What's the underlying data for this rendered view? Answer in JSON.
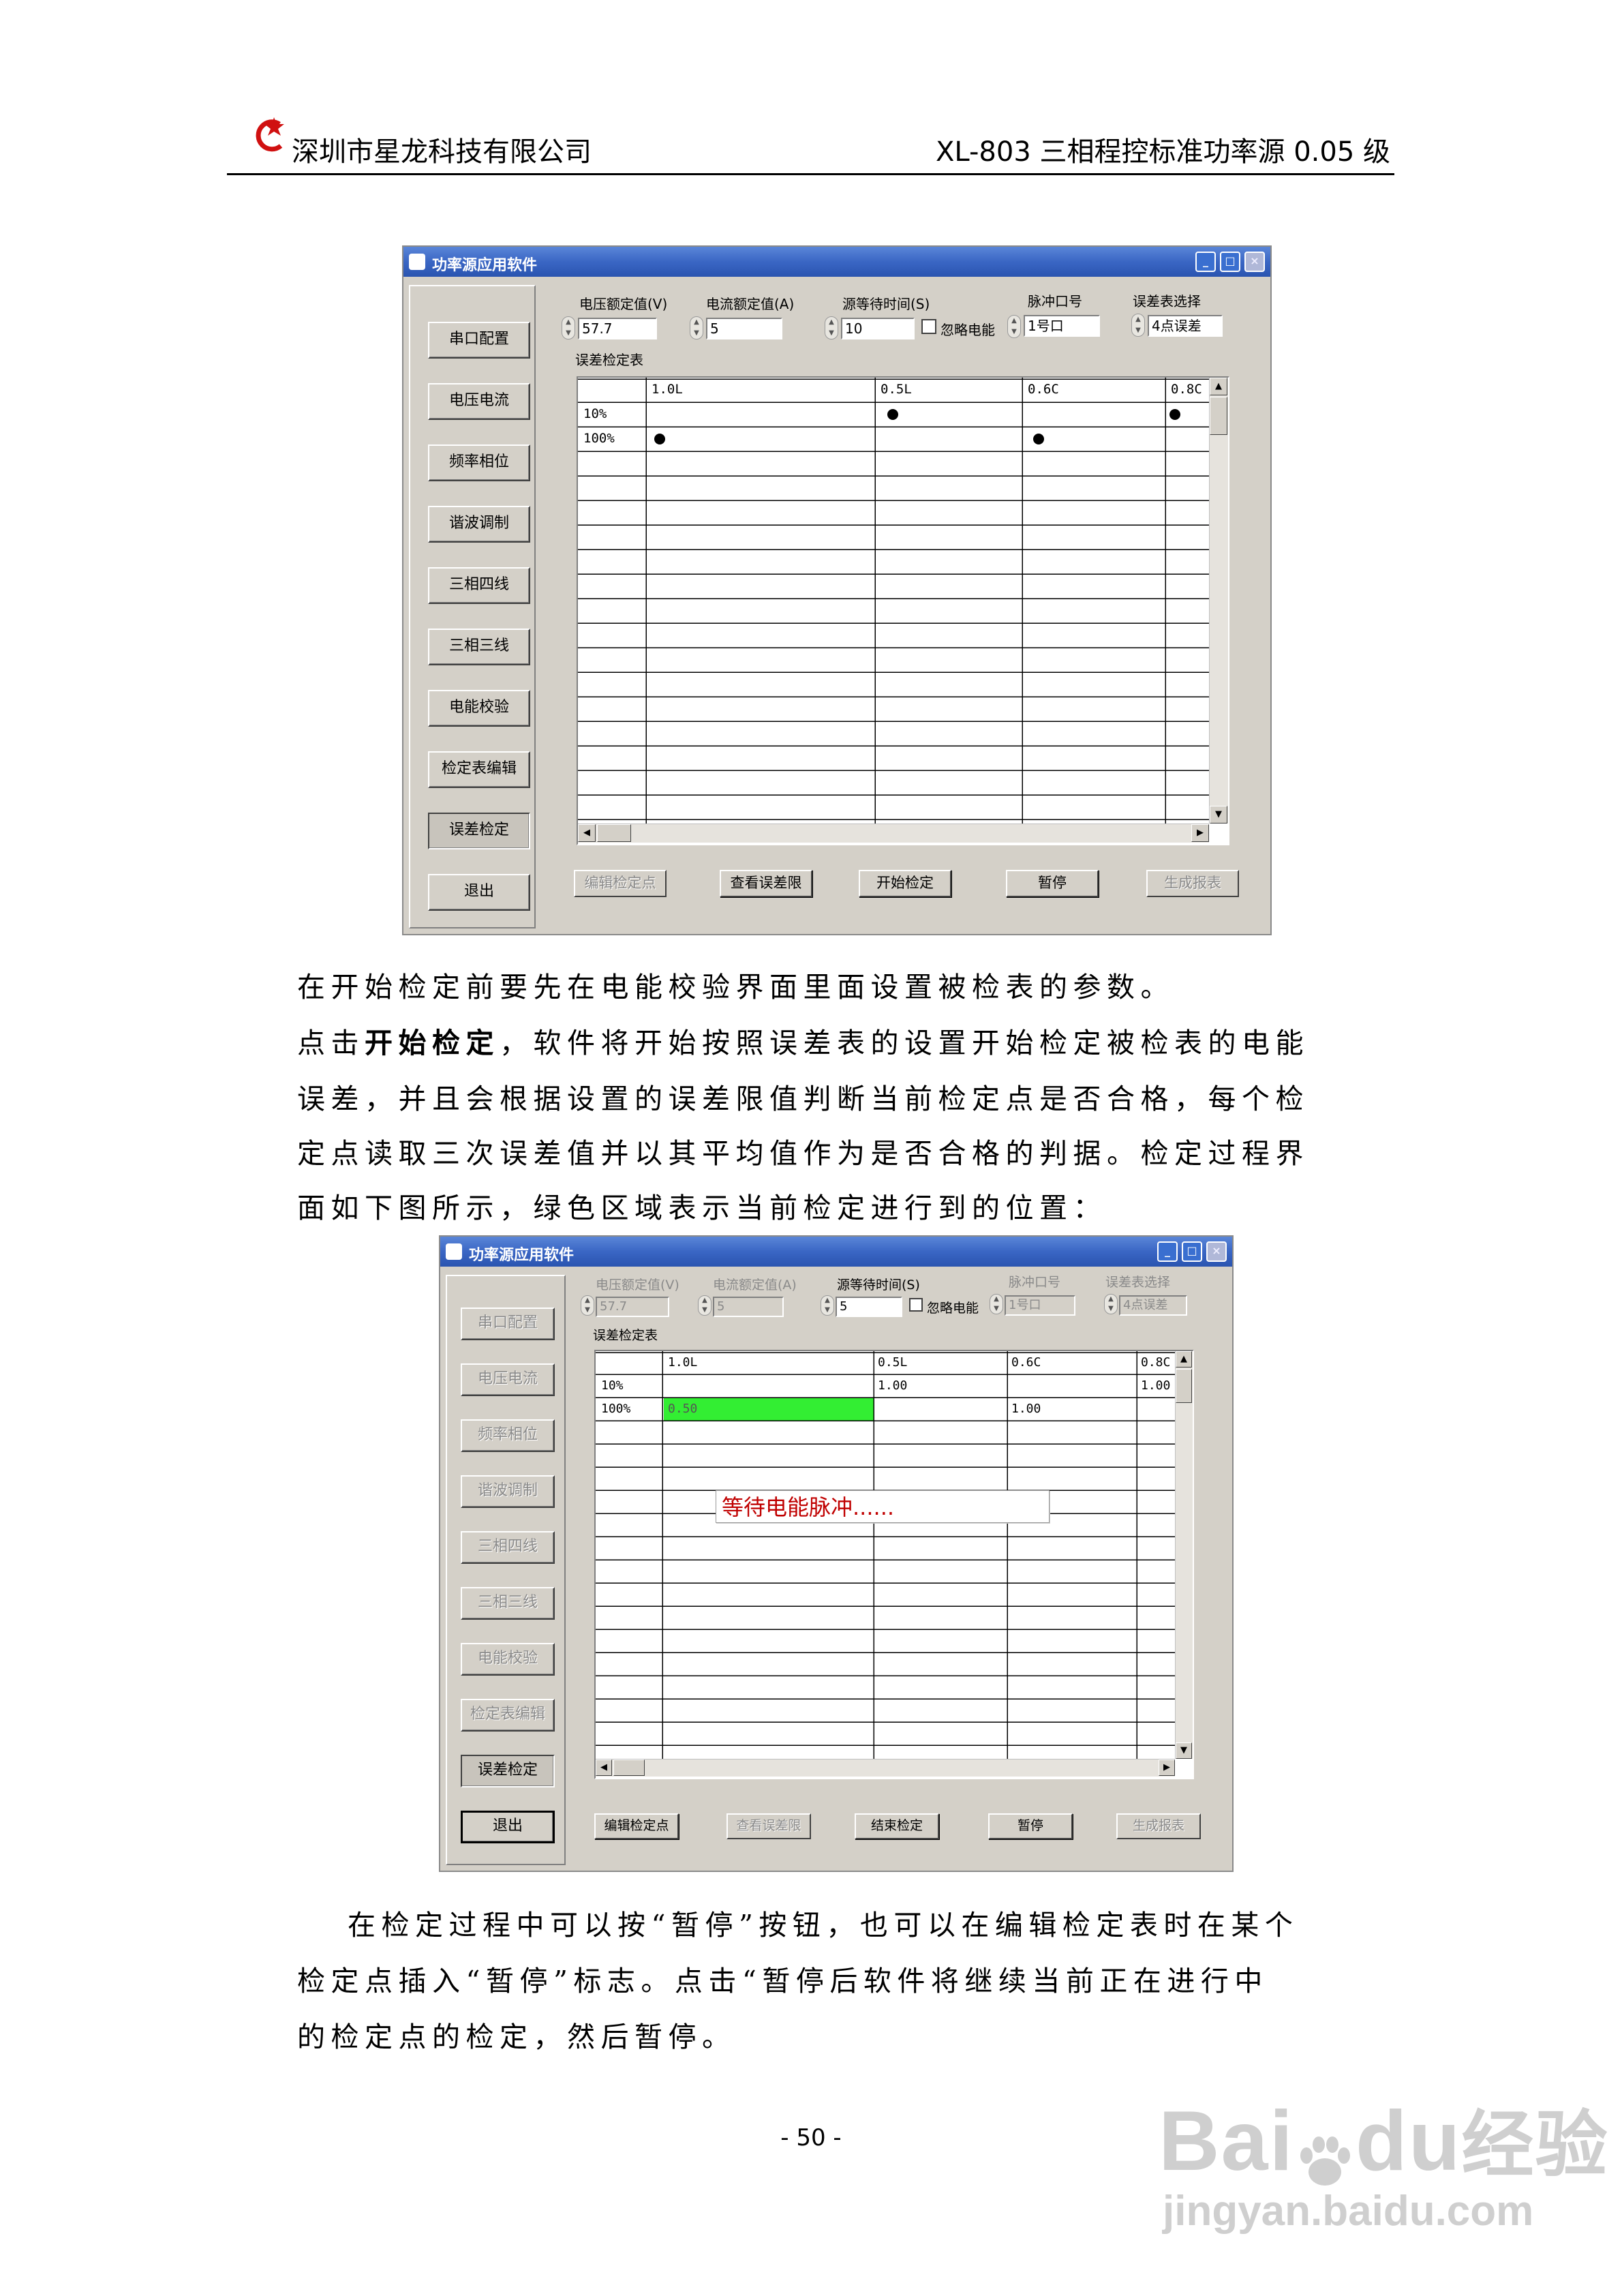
{
  "header": {
    "company": "深圳市星龙科技有限公司",
    "product": "XL-803 三相程控标准功率源 0.05 级"
  },
  "window1": {
    "title": "功率源应用软件",
    "title_buttons": [
      "_",
      "□",
      "×"
    ],
    "nav": [
      "串口配置",
      "电压电流",
      "频率相位",
      "谐波调制",
      "三相四线",
      "三相三线",
      "电能校验",
      "检定表编辑",
      "误差检定",
      "退出"
    ],
    "fields": {
      "voltage_label": "电压额定值(V)",
      "voltage_value": "57.7",
      "current_label": "电流额定值(A)",
      "current_value": "5",
      "wait_label": "源等待时间(S)",
      "wait_value": "10",
      "ignore_label": "忽略电能",
      "pulse_label": "脉冲口号",
      "pulse_value": "1号口",
      "error_label": "误差表选择",
      "error_value": "4点误差"
    },
    "table_label": "误差检定表",
    "columns": [
      "1.0L",
      "0.5L",
      "0.6C",
      "0.8C"
    ],
    "rows": [
      "10%",
      "100%"
    ],
    "buttons": [
      "编辑检定点",
      "查看误差限",
      "开始检定",
      "暂停",
      "生成报表"
    ]
  },
  "para1": "在开始检定前要先在电能校验界面里面设置被检表的参数。",
  "para2": {
    "pre": "点击",
    "bold": "开始检定",
    "post": "，软件将开始按照误差表的设置开始检定被检表的电能",
    "l2": "误差，并且会根据设置的误差限值判断当前检定点是否合格，每个检",
    "l3": "定点读取三次误差值并以其平均值作为是否合格的判据。检定过程界",
    "l4": "面如下图所示，绿色区域表示当前检定进行到的位置："
  },
  "window2": {
    "title": "功率源应用软件",
    "title_buttons": [
      "_",
      "□",
      "×"
    ],
    "nav": [
      "串口配置",
      "电压电流",
      "频率相位",
      "谐波调制",
      "三相四线",
      "三相三线",
      "电能校验",
      "检定表编辑",
      "误差检定",
      "退出"
    ],
    "fields": {
      "voltage_label": "电压额定值(V)",
      "voltage_value": "57.7",
      "current_label": "电流额定值(A)",
      "current_value": "5",
      "wait_label": "源等待时间(S)",
      "wait_value": "5",
      "ignore_label": "忽略电能",
      "pulse_label": "脉冲口号",
      "pulse_value": "1号口",
      "error_label": "误差表选择",
      "error_value": "4点误差"
    },
    "table_label": "误差检定表",
    "columns": [
      "1.0L",
      "0.5L",
      "0.6C",
      "0.8C"
    ],
    "rows": [
      "10%",
      "100%"
    ],
    "cells": {
      "r1_c2": "1.00",
      "r1_c4": "1.00",
      "r2_c1": "0.50",
      "r2_c3": "1.00"
    },
    "popup": "等待电能脉冲......",
    "buttons": [
      "编辑检定点",
      "查看误差限",
      "结束检定",
      "暂停",
      "生成报表"
    ]
  },
  "para3": {
    "l1": "在检定过程中可以按“暂停”按钮，也可以在编辑检定表时在某个",
    "l2": "检定点插入“暂停”标志。点击“暂停后软件将继续当前正在进行中",
    "l3": "的检定点的检定，然后暂停。"
  },
  "page_number": "- 50 -",
  "watermark": {
    "brand": "Bai",
    "brand2": "du",
    "cn": "经验",
    "url": "jingyan.baidu.com"
  },
  "colors": {
    "titlebar": "#3a66c4",
    "active_cell": "#33ee33",
    "popup_text": "#c00000",
    "logo": "#d01010"
  }
}
